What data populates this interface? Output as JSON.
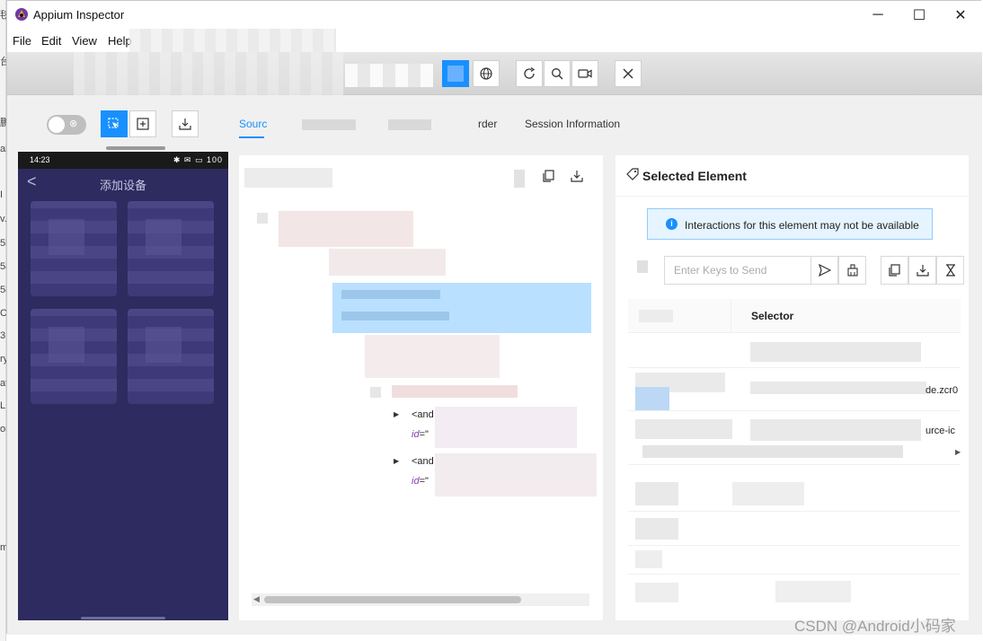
{
  "window": {
    "title": "Appium Inspector",
    "controls": {
      "minimize": "─",
      "maximize": "☐",
      "close": "✕"
    }
  },
  "menubar": {
    "items": [
      "File",
      "Edit",
      "View",
      "Help"
    ]
  },
  "background_window": {
    "fragments": [
      "毬",
      "台",
      "鹏",
      "al",
      "I",
      "v.",
      "5l",
      "58",
      "58",
      "C",
      "3",
      "ry",
      "at",
      "LL",
      "or",
      "m"
    ]
  },
  "sidebar": {
    "toggle_off_symbol": "⊗",
    "phone": {
      "time": "14:23",
      "status_icons": "✱ ✉ ▭ 100",
      "back": "<",
      "title": "添加设备"
    }
  },
  "tabs": {
    "source": "Sourc",
    "recorder": "rder",
    "session_info": "Session Information"
  },
  "source_panel": {
    "lines": [
      {
        "prefix": "<and",
        "attr": "id",
        "suffix": "=\""
      },
      {
        "prefix": "<and",
        "attr": "id",
        "suffix": "=\""
      }
    ],
    "scroll_left": "◀"
  },
  "selected_element": {
    "title": "Selected Element",
    "alert": {
      "icon": "i",
      "text": "Interactions for this element may not be available"
    },
    "keys_input": {
      "placeholder": "Enter Keys to Send",
      "value": ""
    },
    "table": {
      "header": "Selector",
      "visible_fragments": [
        "de.zcr0",
        "urce-ic"
      ],
      "scroll_right": "▶"
    }
  },
  "watermark": "CSDN @Android小码家",
  "colors": {
    "accent": "#1890ff",
    "phone_bg": "#2d2b5f",
    "highlight": "#bae0ff",
    "alert_bg": "#e6f4ff"
  }
}
